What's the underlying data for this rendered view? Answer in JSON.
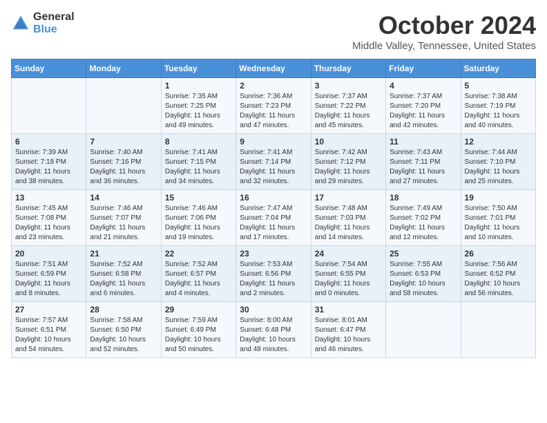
{
  "header": {
    "logo_line1": "General",
    "logo_line2": "Blue",
    "month": "October 2024",
    "location": "Middle Valley, Tennessee, United States"
  },
  "days_of_week": [
    "Sunday",
    "Monday",
    "Tuesday",
    "Wednesday",
    "Thursday",
    "Friday",
    "Saturday"
  ],
  "weeks": [
    [
      {
        "day": "",
        "info": ""
      },
      {
        "day": "",
        "info": ""
      },
      {
        "day": "1",
        "info": "Sunrise: 7:35 AM\nSunset: 7:25 PM\nDaylight: 11 hours and 49 minutes."
      },
      {
        "day": "2",
        "info": "Sunrise: 7:36 AM\nSunset: 7:23 PM\nDaylight: 11 hours and 47 minutes."
      },
      {
        "day": "3",
        "info": "Sunrise: 7:37 AM\nSunset: 7:22 PM\nDaylight: 11 hours and 45 minutes."
      },
      {
        "day": "4",
        "info": "Sunrise: 7:37 AM\nSunset: 7:20 PM\nDaylight: 11 hours and 42 minutes."
      },
      {
        "day": "5",
        "info": "Sunrise: 7:38 AM\nSunset: 7:19 PM\nDaylight: 11 hours and 40 minutes."
      }
    ],
    [
      {
        "day": "6",
        "info": "Sunrise: 7:39 AM\nSunset: 7:18 PM\nDaylight: 11 hours and 38 minutes."
      },
      {
        "day": "7",
        "info": "Sunrise: 7:40 AM\nSunset: 7:16 PM\nDaylight: 11 hours and 36 minutes."
      },
      {
        "day": "8",
        "info": "Sunrise: 7:41 AM\nSunset: 7:15 PM\nDaylight: 11 hours and 34 minutes."
      },
      {
        "day": "9",
        "info": "Sunrise: 7:41 AM\nSunset: 7:14 PM\nDaylight: 11 hours and 32 minutes."
      },
      {
        "day": "10",
        "info": "Sunrise: 7:42 AM\nSunset: 7:12 PM\nDaylight: 11 hours and 29 minutes."
      },
      {
        "day": "11",
        "info": "Sunrise: 7:43 AM\nSunset: 7:11 PM\nDaylight: 11 hours and 27 minutes."
      },
      {
        "day": "12",
        "info": "Sunrise: 7:44 AM\nSunset: 7:10 PM\nDaylight: 11 hours and 25 minutes."
      }
    ],
    [
      {
        "day": "13",
        "info": "Sunrise: 7:45 AM\nSunset: 7:08 PM\nDaylight: 11 hours and 23 minutes."
      },
      {
        "day": "14",
        "info": "Sunrise: 7:46 AM\nSunset: 7:07 PM\nDaylight: 11 hours and 21 minutes."
      },
      {
        "day": "15",
        "info": "Sunrise: 7:46 AM\nSunset: 7:06 PM\nDaylight: 11 hours and 19 minutes."
      },
      {
        "day": "16",
        "info": "Sunrise: 7:47 AM\nSunset: 7:04 PM\nDaylight: 11 hours and 17 minutes."
      },
      {
        "day": "17",
        "info": "Sunrise: 7:48 AM\nSunset: 7:03 PM\nDaylight: 11 hours and 14 minutes."
      },
      {
        "day": "18",
        "info": "Sunrise: 7:49 AM\nSunset: 7:02 PM\nDaylight: 11 hours and 12 minutes."
      },
      {
        "day": "19",
        "info": "Sunrise: 7:50 AM\nSunset: 7:01 PM\nDaylight: 11 hours and 10 minutes."
      }
    ],
    [
      {
        "day": "20",
        "info": "Sunrise: 7:51 AM\nSunset: 6:59 PM\nDaylight: 11 hours and 8 minutes."
      },
      {
        "day": "21",
        "info": "Sunrise: 7:52 AM\nSunset: 6:58 PM\nDaylight: 11 hours and 6 minutes."
      },
      {
        "day": "22",
        "info": "Sunrise: 7:52 AM\nSunset: 6:57 PM\nDaylight: 11 hours and 4 minutes."
      },
      {
        "day": "23",
        "info": "Sunrise: 7:53 AM\nSunset: 6:56 PM\nDaylight: 11 hours and 2 minutes."
      },
      {
        "day": "24",
        "info": "Sunrise: 7:54 AM\nSunset: 6:55 PM\nDaylight: 11 hours and 0 minutes."
      },
      {
        "day": "25",
        "info": "Sunrise: 7:55 AM\nSunset: 6:53 PM\nDaylight: 10 hours and 58 minutes."
      },
      {
        "day": "26",
        "info": "Sunrise: 7:56 AM\nSunset: 6:52 PM\nDaylight: 10 hours and 56 minutes."
      }
    ],
    [
      {
        "day": "27",
        "info": "Sunrise: 7:57 AM\nSunset: 6:51 PM\nDaylight: 10 hours and 54 minutes."
      },
      {
        "day": "28",
        "info": "Sunrise: 7:58 AM\nSunset: 6:50 PM\nDaylight: 10 hours and 52 minutes."
      },
      {
        "day": "29",
        "info": "Sunrise: 7:59 AM\nSunset: 6:49 PM\nDaylight: 10 hours and 50 minutes."
      },
      {
        "day": "30",
        "info": "Sunrise: 8:00 AM\nSunset: 6:48 PM\nDaylight: 10 hours and 48 minutes."
      },
      {
        "day": "31",
        "info": "Sunrise: 8:01 AM\nSunset: 6:47 PM\nDaylight: 10 hours and 46 minutes."
      },
      {
        "day": "",
        "info": ""
      },
      {
        "day": "",
        "info": ""
      }
    ]
  ]
}
